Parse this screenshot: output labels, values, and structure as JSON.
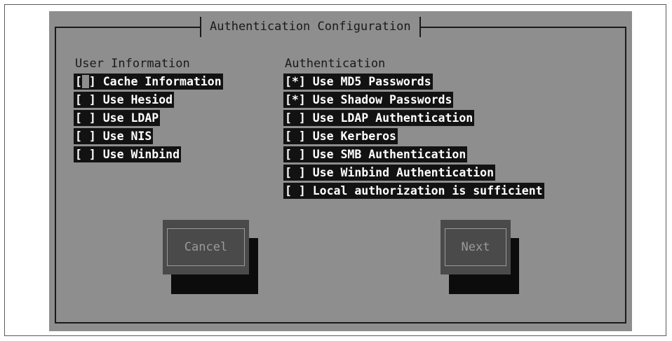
{
  "dialog": {
    "title": "Authentication Configuration"
  },
  "user_information": {
    "heading": "User Information",
    "items": [
      {
        "mark": "[ ]",
        "label": "Cache Information",
        "checked": false
      },
      {
        "mark": "[ ]",
        "label": "Use Hesiod",
        "checked": false
      },
      {
        "mark": "[ ]",
        "label": "Use LDAP",
        "checked": false
      },
      {
        "mark": "[ ]",
        "label": "Use NIS",
        "checked": false
      },
      {
        "mark": "[ ]",
        "label": "Use Winbind",
        "checked": false
      }
    ]
  },
  "authentication": {
    "heading": "Authentication",
    "items": [
      {
        "mark": "[*]",
        "label": "Use MD5 Passwords",
        "checked": true
      },
      {
        "mark": "[*]",
        "label": "Use Shadow Passwords",
        "checked": true
      },
      {
        "mark": "[ ]",
        "label": "Use LDAP Authentication",
        "checked": false
      },
      {
        "mark": "[ ]",
        "label": "Use Kerberos",
        "checked": false
      },
      {
        "mark": "[ ]",
        "label": "Use SMB Authentication",
        "checked": false
      },
      {
        "mark": "[ ]",
        "label": "Use Winbind Authentication",
        "checked": false
      },
      {
        "mark": "[ ]",
        "label": "Local authorization is sufficient",
        "checked": false
      }
    ]
  },
  "buttons": {
    "cancel": "Cancel",
    "next": "Next"
  }
}
